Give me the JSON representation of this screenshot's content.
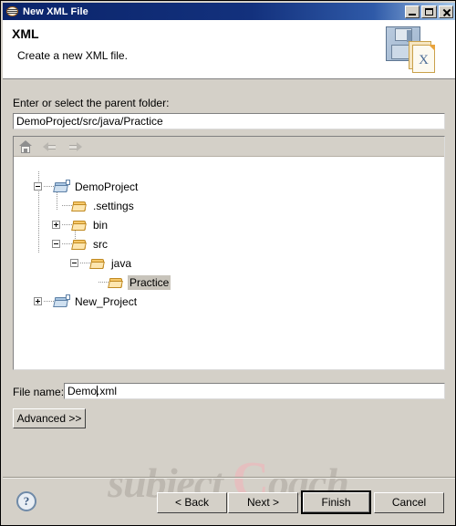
{
  "window": {
    "title": "New XML File",
    "icon": "eclipse-wizard-icon",
    "minimize_label": "Minimize",
    "maximize_label": "Maximize",
    "close_label": "Close"
  },
  "header": {
    "title": "XML",
    "description": "Create a new XML file.",
    "icon": "xml-file-save-icon"
  },
  "parent_folder": {
    "label": "Enter or select the parent folder:",
    "value": "DemoProject/src/java/Practice"
  },
  "tree_toolbar": {
    "home_label": "Home",
    "back_label": "Back",
    "forward_label": "Forward"
  },
  "tree": {
    "nodes": [
      {
        "label": "DemoProject",
        "kind": "project",
        "state": "expanded",
        "selected": false
      },
      {
        "label": ".settings",
        "kind": "folder",
        "state": "leaf",
        "selected": false
      },
      {
        "label": "bin",
        "kind": "folder",
        "state": "collapsed",
        "selected": false
      },
      {
        "label": "src",
        "kind": "folder",
        "state": "expanded",
        "selected": false
      },
      {
        "label": "java",
        "kind": "folder",
        "state": "expanded",
        "selected": false
      },
      {
        "label": "Practice",
        "kind": "folder",
        "state": "leaf",
        "selected": true
      },
      {
        "label": "New_Project",
        "kind": "project",
        "state": "collapsed",
        "selected": false
      }
    ]
  },
  "file_name": {
    "label": "File name:",
    "value_before_caret": "Demo",
    "value_after_caret": ".xml",
    "value": "Demo.xml"
  },
  "advanced_button": {
    "label": "Advanced >>"
  },
  "watermark": {
    "part1": "subject ",
    "cap": "C",
    "part2": "oach"
  },
  "footer": {
    "help_label": "?",
    "back_label": "< Back",
    "next_label": "Next >",
    "finish_label": "Finish",
    "cancel_label": "Cancel"
  },
  "colors": {
    "dialog_background": "#d4d0c8",
    "titlebar_start": "#0a246a",
    "titlebar_end": "#a6c8ea",
    "selection": "#c8c4bb",
    "folder_accent": "#f6c86a",
    "project_accent": "#a9c6e2"
  }
}
